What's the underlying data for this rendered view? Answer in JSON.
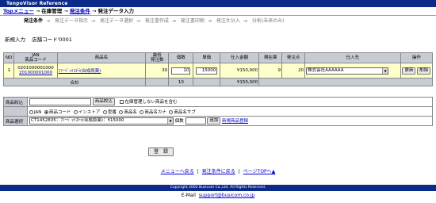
{
  "app_title": "TenpoVisor Reference",
  "breadcrumb": {
    "top": "Topメニュー",
    "sep": " → ",
    "mid1": "在庫管理",
    "mid2": "発注条件",
    "current": "発注データ入力"
  },
  "steps": [
    "発注条件",
    "発注データ指示",
    "発注データ選択",
    "発注書作成",
    "発注書印刷",
    "発注仕分入",
    "分析(未来のみ)"
  ],
  "entry": {
    "mode": "新規入力",
    "store": "店舗コード'0001"
  },
  "table": {
    "headers": [
      "NO",
      "JAN\n商品コード",
      "商品名",
      "最低\n発注数",
      "個数",
      "単価",
      "仕入金額",
      "現在庫",
      "発注点",
      "仕入先",
      "操作"
    ],
    "row": {
      "no": "1",
      "jan": "0201000001000",
      "code": "201000001000",
      "name": "ﾌｧｰﾍﾞｯﾄｺﾅﾗ(台成原薬)",
      "min_qty": "30",
      "qty": "10",
      "price": "15000",
      "amount": "¥150,000",
      "stock": "9",
      "reorder": "20",
      "supplier": "株式会社AAAAAA",
      "update_label": "更新",
      "delete_label": "削除"
    },
    "total": {
      "label": "合計",
      "qty": "10",
      "amount": "¥150,000"
    }
  },
  "filter": {
    "narrow_label": "商品絞込",
    "narrow_button": "商品絞込",
    "include_unmanaged": "在庫管理しない商品を含む",
    "radios": [
      "JAN",
      "商品コード",
      "インストア",
      "型番",
      "商品名",
      "商品名カナ",
      "商品名サブ"
    ],
    "radio_selected": 1,
    "select_label": "商品選択",
    "select_value": "CT1452835：ﾌｧｰﾍﾞｯﾄｺﾅﾗ(台成原薬)：¥15000",
    "qty_label": "個数",
    "add_button": "追加",
    "new_product_link": "新規商品登録"
  },
  "submit": "登　録",
  "footer_links": [
    "メニューへ戻る",
    "発注条件に戻る",
    "ページTOPへ▲"
  ],
  "footer_sep": "|",
  "copyright": "Copyright 2002 Busicom Co.,Ltd. All Rights Reserved.",
  "email_label": "E-Mail",
  "email": "support@busicom.co.jp"
}
